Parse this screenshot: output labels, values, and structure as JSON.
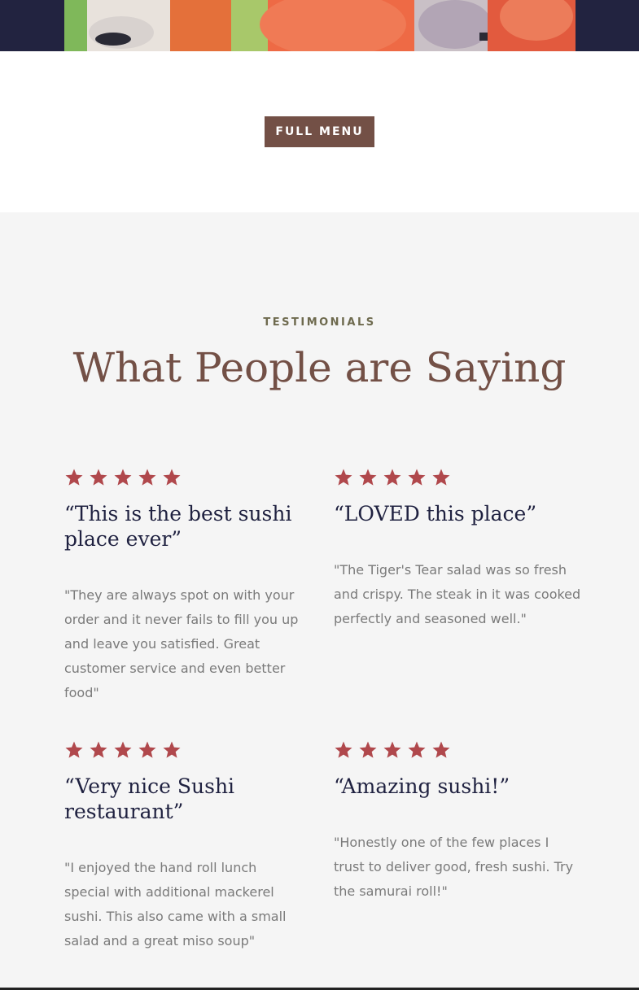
{
  "hero": {
    "image_alt": "sushi roll close-up"
  },
  "menu": {
    "button_label": "FULL MENU"
  },
  "testimonials": {
    "eyebrow": "TESTIMONIALS",
    "title": "What People are Saying",
    "star_color": "#b0484c",
    "reviews": [
      {
        "rating": 5,
        "title": "“This is the best sushi place ever”",
        "body": "\"They are always spot on with your order and it never fails to fill you up and leave you satisfied. Great customer service and even better food\""
      },
      {
        "rating": 5,
        "title": "“LOVED this place”",
        "body": "\"The Tiger's Tear salad was so fresh and crispy. The steak in it was cooked perfectly and seasoned well.\""
      },
      {
        "rating": 5,
        "title": "“Very nice Sushi restaurant”",
        "body": "\"I enjoyed the hand roll lunch special with additional mackerel sushi. This also came with a small salad and a great miso soup\""
      },
      {
        "rating": 5,
        "title": "“Amazing sushi!”",
        "body": "\"Honestly one of the few places I trust to deliver good, fresh sushi. Try the samurai roll!\""
      }
    ]
  }
}
